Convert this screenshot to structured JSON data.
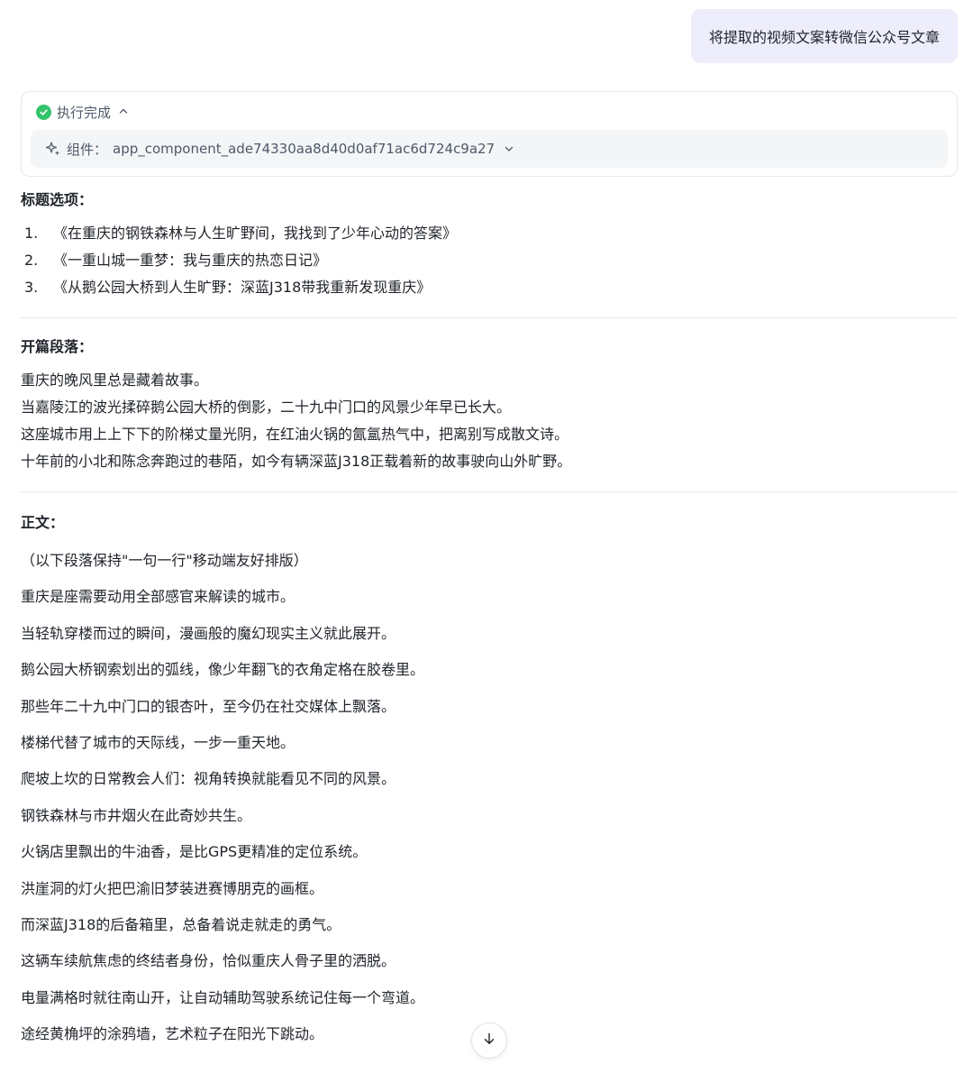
{
  "user_message": "将提取的视频文案转微信公众号文章",
  "execution": {
    "status": "执行完成",
    "component_label": "组件：",
    "component_id": "app_component_ade74330aa8d40d0af71ac6d724c9a27"
  },
  "titles_section": {
    "heading": "标题选项：",
    "items": [
      {
        "num": "1.",
        "text": "《在重庆的钢铁森林与人生旷野间，我找到了少年心动的答案》"
      },
      {
        "num": "2.",
        "text": "《一重山城一重梦：我与重庆的热恋日记》"
      },
      {
        "num": "3.",
        "text": "《从鹅公园大桥到人生旷野：深蓝J318带我重新发现重庆》"
      }
    ]
  },
  "opening_section": {
    "heading": "开篇段落：",
    "lines": [
      "重庆的晚风里总是藏着故事。",
      "当嘉陵江的波光揉碎鹅公园大桥的倒影，二十九中门口的风景少年早已长大。",
      "这座城市用上上下下的阶梯丈量光阴，在红油火锅的氤氲热气中，把离别写成散文诗。",
      "十年前的小北和陈念奔跑过的巷陌，如今有辆深蓝J318正载着新的故事驶向山外旷野。"
    ]
  },
  "body_section": {
    "heading": "正文：",
    "lines": [
      "（以下段落保持\"一句一行\"移动端友好排版）",
      "重庆是座需要动用全部感官来解读的城市。",
      "当轻轨穿楼而过的瞬间，漫画般的魔幻现实主义就此展开。",
      "鹅公园大桥钢索划出的弧线，像少年翻飞的衣角定格在胶卷里。",
      "那些年二十九中门口的银杏叶，至今仍在社交媒体上飘落。",
      "楼梯代替了城市的天际线，一步一重天地。",
      "爬坡上坎的日常教会人们：视角转换就能看见不同的风景。",
      "钢铁森林与市井烟火在此奇妙共生。",
      "火锅店里飘出的牛油香，是比GPS更精准的定位系统。",
      "洪崖洞的灯火把巴渝旧梦装进赛博朋克的画框。",
      "而深蓝J318的后备箱里，总备着说走就走的勇气。",
      "这辆车续航焦虑的终结者身份，恰似重庆人骨子里的洒脱。",
      "电量满格时就往南山开，让自动辅助驾驶系统记住每一个弯道。",
      "途经黄桷坪的涂鸦墙，艺术粒子在阳光下跳动。"
    ]
  },
  "icons": {
    "status": "check-circle-icon",
    "component": "sparkle-icon",
    "scroll": "arrow-down-icon"
  }
}
